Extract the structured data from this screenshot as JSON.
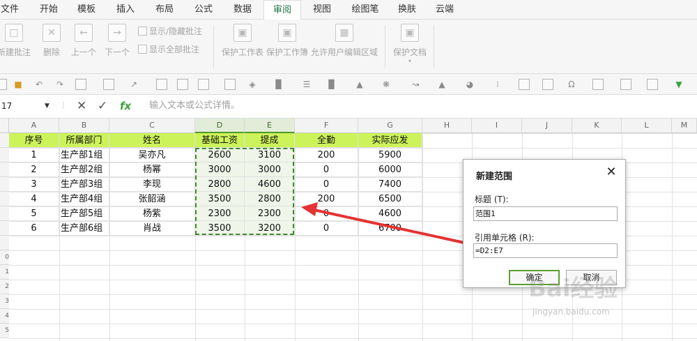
{
  "menu": [
    "文件",
    "开始",
    "模板",
    "插入",
    "布局",
    "公式",
    "数据",
    "审阅",
    "视图",
    "绘图笔",
    "换肤",
    "云端"
  ],
  "ribbon": {
    "new_comment": "新建批注",
    "delete": "删除",
    "prev": "上一个",
    "next": "下一个",
    "show_hide_comment": "显示/隐藏批注",
    "show_all_comments": "显示全部批注",
    "protect_sheet": "保护工作表",
    "protect_workbook": "保护工作簿",
    "allow_edit_ranges": "允许用户编辑区域",
    "protect_document": "保护文档"
  },
  "formula_bar": {
    "name_box": "17",
    "placeholder": "输入文本或公式详情。"
  },
  "columns": [
    "A",
    "B",
    "C",
    "D",
    "E",
    "F",
    "G",
    "H",
    "I",
    "J",
    "K",
    "L",
    "M"
  ],
  "rows_visible": [
    "",
    "",
    "",
    "",
    "",
    "",
    "",
    "",
    "0",
    "1",
    "2",
    "3",
    "4",
    "5"
  ],
  "table": {
    "headers": [
      "序号",
      "所属部门",
      "姓名",
      "基础工资",
      "提成",
      "全勤",
      "实际应发"
    ],
    "rows": [
      [
        "1",
        "生产部1组",
        "吴亦凡",
        "2600",
        "3100",
        "200",
        "5900"
      ],
      [
        "2",
        "生产部2组",
        "杨幂",
        "3000",
        "3000",
        "0",
        "6000"
      ],
      [
        "3",
        "生产部3组",
        "李现",
        "2800",
        "4600",
        "0",
        "7400"
      ],
      [
        "4",
        "生产部4组",
        "张韶涵",
        "3500",
        "2800",
        "200",
        "6500"
      ],
      [
        "5",
        "生产部5组",
        "杨紫",
        "2300",
        "2300",
        "0",
        "4600"
      ],
      [
        "6",
        "生产部6组",
        "肖战",
        "3500",
        "3200",
        "0",
        "6700"
      ]
    ]
  },
  "dialog": {
    "title": "新建范围",
    "title_label": "标题 (T):",
    "title_value": "范围1",
    "ref_label": "引用单元格 (R):",
    "ref_value": "=D2:E7",
    "ok": "确定",
    "cancel": "取消"
  },
  "watermark": {
    "brand": "Bai经验",
    "url": "jingyan.baidu.com"
  },
  "colors": {
    "header_fill": "#ccf35a",
    "accent": "#217346",
    "annotation_red": "#e53232"
  }
}
